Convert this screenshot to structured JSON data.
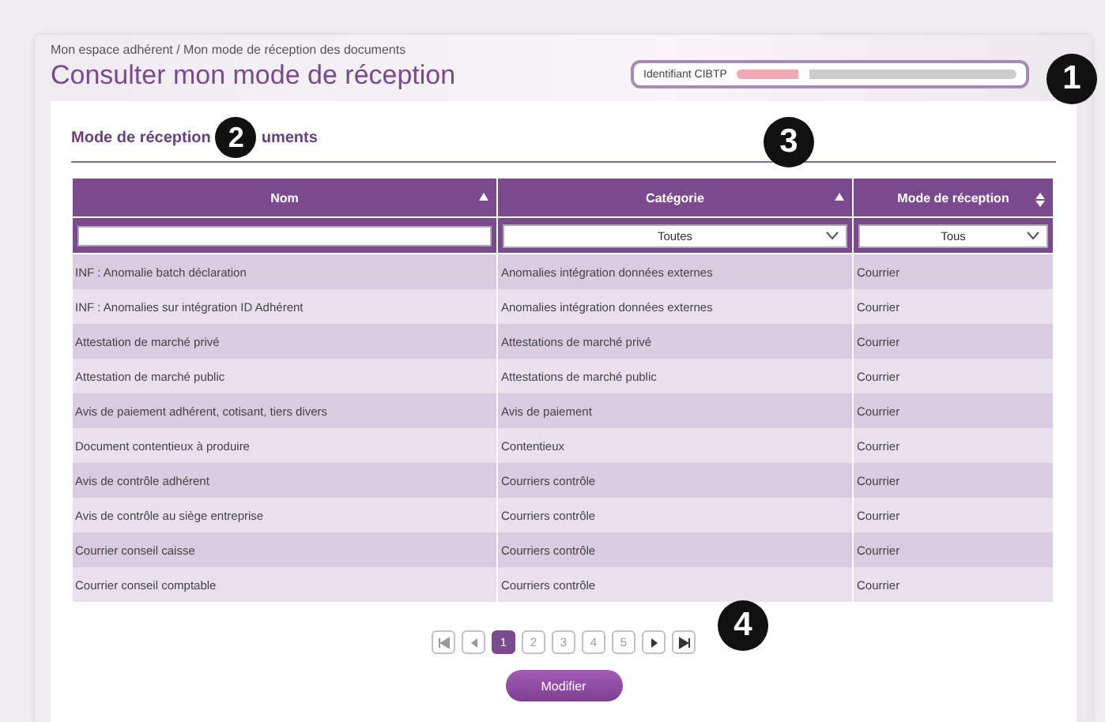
{
  "breadcrumb": "Mon espace adhérent / Mon mode de réception des documents",
  "title": "Consulter mon mode de réception",
  "identifier": {
    "label": "Identifiant CIBTP"
  },
  "section": {
    "title_parts": [
      "Mode de réception",
      "uments"
    ]
  },
  "table": {
    "columns": [
      {
        "label": "Nom",
        "kind": "ascending"
      },
      {
        "label": "Catégorie",
        "kind": "ascending"
      },
      {
        "label": "Mode de réception",
        "kind": "sortable"
      }
    ],
    "filters": [
      {
        "kind": "text"
      },
      {
        "kind": "select",
        "value": "Toutes"
      },
      {
        "kind": "select",
        "value": "Tous"
      }
    ],
    "rows": [
      [
        "INF : Anomalie batch déclaration",
        "Anomalies intégration données externes",
        "Courrier"
      ],
      [
        "INF : Anomalies sur intégration ID Adhérent",
        "Anomalies intégration données externes",
        "Courrier"
      ],
      [
        "Attestation de marché privé",
        "Attestations de marché privé",
        "Courrier"
      ],
      [
        "Attestation de marché public",
        "Attestations de marché public",
        "Courrier"
      ],
      [
        "Avis de paiement adhérent, cotisant, tiers divers",
        "Avis de paiement",
        "Courrier"
      ],
      [
        "Document contentieux à produire",
        "Contentieux",
        "Courrier"
      ],
      [
        "Avis de contrôle adhérent",
        "Courriers contrôle",
        "Courrier"
      ],
      [
        "Avis de contrôle au siège entreprise",
        "Courriers contrôle",
        "Courrier"
      ],
      [
        "Courrier conseil caisse",
        "Courriers contrôle",
        "Courrier"
      ],
      [
        "Courrier conseil comptable",
        "Courriers contrôle",
        "Courrier"
      ]
    ]
  },
  "pagination": [
    {
      "kind": "first",
      "selected": false
    },
    {
      "kind": "prev",
      "selected": false
    },
    {
      "kind": "page",
      "label": "1",
      "selected": true
    },
    {
      "kind": "page",
      "label": "2",
      "selected": false
    },
    {
      "kind": "page",
      "label": "3",
      "selected": false
    },
    {
      "kind": "page",
      "label": "4",
      "selected": false
    },
    {
      "kind": "page",
      "label": "5",
      "selected": false
    },
    {
      "kind": "next",
      "selected": false
    },
    {
      "kind": "last",
      "selected": false
    }
  ],
  "button": "Modifier",
  "callouts": [
    "1",
    "2",
    "3",
    "4"
  ]
}
